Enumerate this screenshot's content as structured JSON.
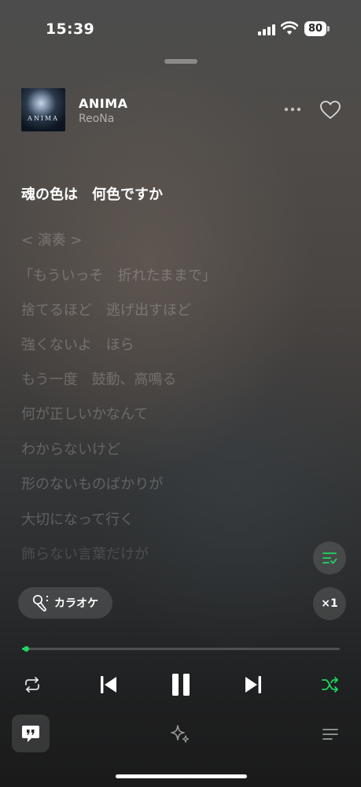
{
  "status_bar": {
    "time": "15:39",
    "battery": "80"
  },
  "now_playing": {
    "title": "ANIMA",
    "artist": "ReoNa",
    "art_text": "ANIMA"
  },
  "lyrics": [
    {
      "text": "魂の色は　何色ですか",
      "state": "current"
    },
    {
      "text": "< 演奏 >",
      "state": "dim"
    },
    {
      "text": "「もういっそ　折れたままで」",
      "state": "dim"
    },
    {
      "text": "捨てるほど　逃げ出すほど",
      "state": "dim"
    },
    {
      "text": "強くないよ　ほら",
      "state": "dim"
    },
    {
      "text": "もう一度　鼓動、高鳴る",
      "state": "dim"
    },
    {
      "text": "何が正しいかなんて",
      "state": "dim"
    },
    {
      "text": "わからないけど",
      "state": "dim"
    },
    {
      "text": "形のないものばかりが",
      "state": "dim"
    },
    {
      "text": "大切になって行く",
      "state": "dim"
    },
    {
      "text": "飾らない言葉だけが",
      "state": "faint"
    }
  ],
  "karaoke": {
    "label": "カラオケ",
    "icon": "karaoke-mic-icon"
  },
  "speed": {
    "label": "×1"
  },
  "progress": {
    "fraction": 0.01
  },
  "colors": {
    "accent": "#1ed760"
  }
}
